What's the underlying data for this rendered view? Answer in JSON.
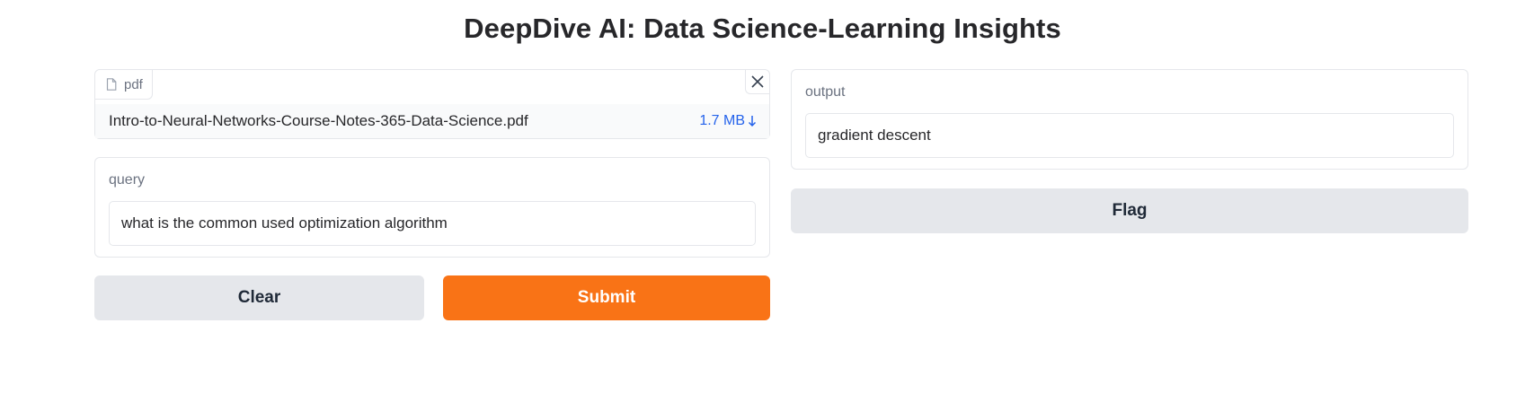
{
  "header": {
    "title": "DeepDive AI: Data Science-Learning Insights"
  },
  "file_input": {
    "tab_label": "pdf",
    "tab_icon": "file-icon",
    "close_icon": "close-icon",
    "file_name": "Intro-to-Neural-Networks-Course-Notes-365-Data-Science.pdf",
    "file_size": "1.7 MB",
    "download_icon": "download-icon"
  },
  "query": {
    "label": "query",
    "value": "what is the common used optimization algorithm"
  },
  "output": {
    "label": "output",
    "value": "gradient descent"
  },
  "buttons": {
    "clear": "Clear",
    "submit": "Submit",
    "flag": "Flag"
  },
  "colors": {
    "accent": "#f97316",
    "link": "#2563eb",
    "secondary_button": "#e5e7eb"
  }
}
